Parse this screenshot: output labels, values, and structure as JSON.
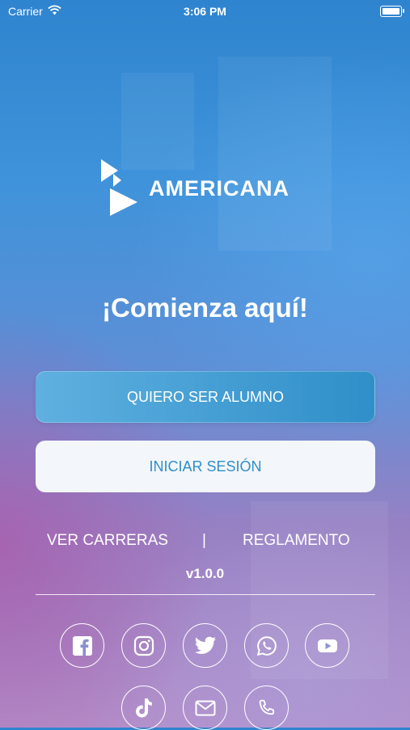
{
  "status_bar": {
    "carrier": "Carrier",
    "time": "3:06 PM"
  },
  "brand": {
    "name": "AMERICANA"
  },
  "headline": "¡Comienza aquí!",
  "buttons": {
    "primary": "QUIERO SER ALUMNO",
    "secondary": "INICIAR SESIÓN"
  },
  "links": {
    "left": "VER CARRERAS",
    "separator": "|",
    "right": "REGLAMENTO"
  },
  "version": "v1.0.0",
  "social": [
    "facebook-icon",
    "instagram-icon",
    "twitter-icon",
    "whatsapp-icon",
    "youtube-icon",
    "tiktok-icon",
    "mail-icon",
    "phone-icon"
  ],
  "colors": {
    "accent": "#2f8fc8",
    "button_light": "#f3f6fa"
  }
}
